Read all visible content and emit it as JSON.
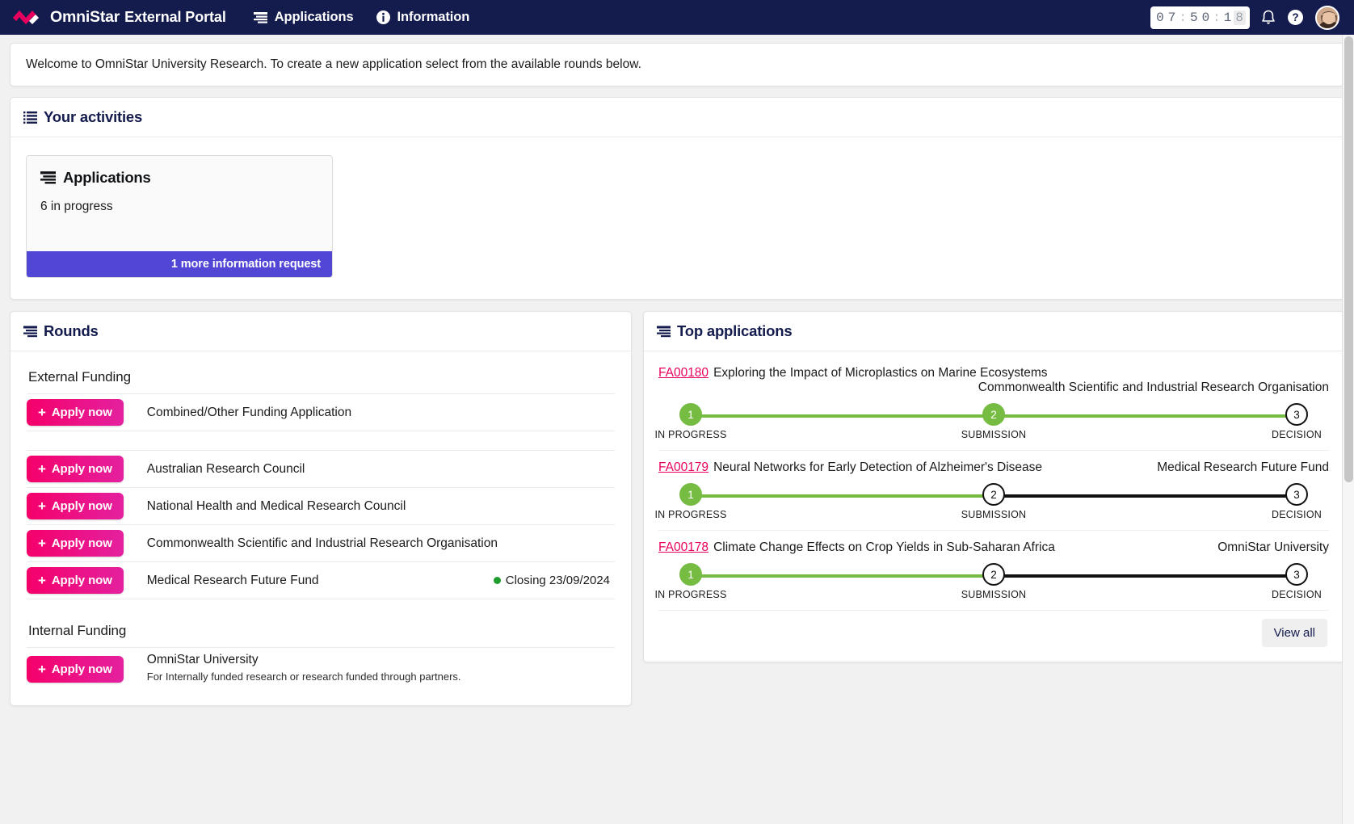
{
  "header": {
    "brand": "OmniStar",
    "portal": "External Portal",
    "nav": [
      {
        "label": "Applications",
        "icon": "stack-icon"
      },
      {
        "label": "Information",
        "icon": "info-icon"
      }
    ],
    "timer": {
      "digits": [
        "0",
        "7",
        "5",
        "0",
        "1",
        "8"
      ],
      "value": "07:50:18"
    },
    "bell_icon": "bell-icon",
    "help_icon": "question-mark-icon",
    "avatar": "user-avatar"
  },
  "welcome": {
    "message": "Welcome to OmniStar University Research.  To create a new application select from the available rounds below."
  },
  "activities": {
    "title": "Your activities",
    "tile": {
      "title": "Applications",
      "subtitle": "6 in progress",
      "footer": "1 more information request",
      "footer_color": "#5146d6"
    }
  },
  "rounds": {
    "title": "Rounds",
    "apply_label": "Apply now",
    "groups": [
      {
        "name": "External Funding",
        "items": [
          {
            "label": "Combined/Other Funding Application",
            "closing": ""
          },
          {
            "label": "Australian Research Council",
            "closing": ""
          },
          {
            "label": "National Health and Medical Research Council",
            "closing": ""
          },
          {
            "label": "Commonwealth Scientific and Industrial Research Organisation",
            "closing": ""
          },
          {
            "label": "Medical Research Future Fund",
            "closing": "Closing 23/09/2024"
          }
        ]
      },
      {
        "name": "Internal Funding",
        "items": [
          {
            "label": "OmniStar University",
            "description": "For Internally funded research or research funded through partners.",
            "closing": ""
          }
        ]
      }
    ]
  },
  "top_applications": {
    "title": "Top applications",
    "view_all": "View all",
    "step_labels": [
      "IN PROGRESS",
      "SUBMISSION",
      "DECISION"
    ],
    "colors": {
      "done": "#76bc43",
      "todo": "#111111",
      "link": "#e8005e"
    },
    "rows": [
      {
        "id": "FA00180",
        "title": "Exploring the Impact of Microplastics on Marine Ecosystems",
        "org": "Commonwealth Scientific and Industrial Research Organisation",
        "org_wraps": true,
        "steps": [
          {
            "n": "1",
            "state": "done"
          },
          {
            "n": "2",
            "state": "done"
          },
          {
            "n": "3",
            "state": "todo"
          }
        ],
        "segments": [
          "green",
          "green"
        ]
      },
      {
        "id": "FA00179",
        "title": "Neural Networks for Early Detection of Alzheimer's Disease",
        "org": "Medical Research Future Fund",
        "org_wraps": false,
        "steps": [
          {
            "n": "1",
            "state": "done"
          },
          {
            "n": "2",
            "state": "todo"
          },
          {
            "n": "3",
            "state": "todo"
          }
        ],
        "segments": [
          "green",
          "black"
        ]
      },
      {
        "id": "FA00178",
        "title": "Climate Change Effects on Crop Yields in Sub-Saharan Africa",
        "org": "OmniStar University",
        "org_wraps": false,
        "steps": [
          {
            "n": "1",
            "state": "done"
          },
          {
            "n": "2",
            "state": "todo"
          },
          {
            "n": "3",
            "state": "todo"
          }
        ],
        "segments": [
          "green",
          "black"
        ]
      }
    ]
  }
}
